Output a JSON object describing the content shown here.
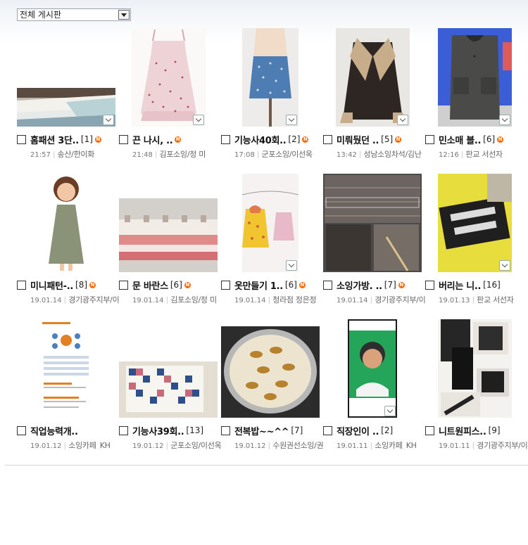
{
  "board_select": {
    "selected": "전체 게시판"
  },
  "posts": [
    {
      "title": "홈패션 3단..",
      "count": "[1]",
      "new": true,
      "time": "21:57",
      "writer": "송산/한이화",
      "img": "bedsheet"
    },
    {
      "title": "끈 나시, ..",
      "count": "",
      "new": true,
      "time": "21:48",
      "writer": "김포소잉/정 미",
      "img": "camisole"
    },
    {
      "title": "기능사40회..",
      "count": "[2]",
      "new": true,
      "time": "17:08",
      "writer": "군포소잉/이선옥",
      "img": "skirt"
    },
    {
      "title": "미뤄뒀던 ..",
      "count": "[5]",
      "new": true,
      "time": "13:42",
      "writer": "성남소잉차석/김난",
      "img": "coat"
    },
    {
      "title": "민소매 블..",
      "count": "[6]",
      "new": true,
      "time": "12:16",
      "writer": "판교 서선자",
      "img": "vest"
    },
    {
      "title": "미니패턴-..",
      "count": "[8]",
      "new": true,
      "time": "19.01.14",
      "writer": "경기광주지부/이",
      "img": "doll"
    },
    {
      "title": "문 바란스",
      "count": "[6]",
      "new": true,
      "time": "19.01.14",
      "writer": "김포소잉/정 미",
      "img": "valance"
    },
    {
      "title": "옷만들기 1..",
      "count": "[6]",
      "new": true,
      "time": "19.01.14",
      "writer": "청라점 정은정",
      "img": "babydress"
    },
    {
      "title": "소잉가방. ..",
      "count": "[7]",
      "new": true,
      "time": "19.01.14",
      "writer": "경기광주지부/이",
      "img": "handmade"
    },
    {
      "title": "버리는 니..",
      "count": "[16]",
      "new": false,
      "time": "19.01.13",
      "writer": "판교 서선자",
      "img": "lovepink"
    },
    {
      "title": "직업능력개..",
      "count": "",
      "new": false,
      "time": "19.01.12",
      "writer": "소잉카페_KH",
      "img": "document"
    },
    {
      "title": "기능사39회..",
      "count": "[13]",
      "new": false,
      "time": "19.01.12",
      "writer": "군포소잉/이선옥",
      "img": "quilt"
    },
    {
      "title": "전복밥~~^^",
      "count": "[7]",
      "new": false,
      "time": "19.01.12",
      "writer": "수원권선소잉/권",
      "img": "rice"
    },
    {
      "title": "직장인이 ..",
      "count": "[2]",
      "new": false,
      "time": "19.01.11",
      "writer": "소잉카페_KH",
      "img": "phone"
    },
    {
      "title": "니트원피스..",
      "count": "[9]",
      "new": false,
      "time": "19.01.11",
      "writer": "경기광주지부/이",
      "img": "collage"
    }
  ],
  "icons": {
    "new_badge": "N",
    "new_color": "#ff6a00"
  }
}
